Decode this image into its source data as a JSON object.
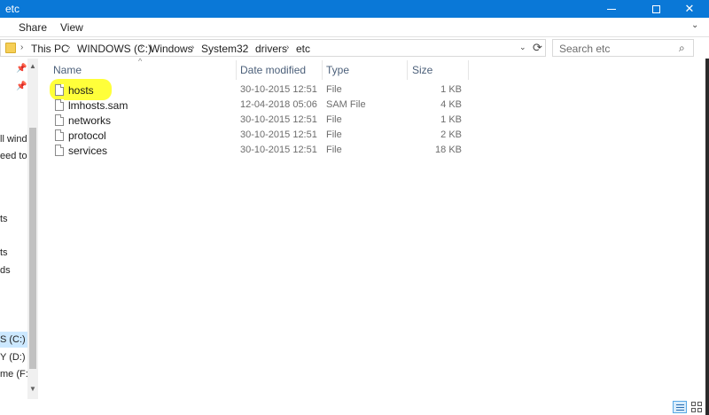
{
  "window": {
    "title": "etc",
    "accent_color": "#0a78d7"
  },
  "ribbon": {
    "tabs": [
      "Share",
      "View"
    ]
  },
  "address": {
    "crumbs": [
      "This PC",
      "WINDOWS (C:)",
      "Windows",
      "System32",
      "drivers",
      "etc"
    ]
  },
  "search": {
    "placeholder": "Search etc"
  },
  "nav": {
    "items": [
      "ll wind",
      "eed to b",
      "ts",
      "ts",
      "ds",
      "S (C:)",
      "Y (D:)",
      "me (F:)"
    ]
  },
  "columns": [
    "Name",
    "Date modified",
    "Type",
    "Size"
  ],
  "files": [
    {
      "name": "hosts",
      "date": "30-10-2015 12:51",
      "type": "File",
      "size": "1 KB",
      "highlighted": true
    },
    {
      "name": "lmhosts.sam",
      "date": "12-04-2018 05:06",
      "type": "SAM File",
      "size": "4 KB",
      "highlighted": false
    },
    {
      "name": "networks",
      "date": "30-10-2015 12:51",
      "type": "File",
      "size": "1 KB",
      "highlighted": false
    },
    {
      "name": "protocol",
      "date": "30-10-2015 12:51",
      "type": "File",
      "size": "2 KB",
      "highlighted": false
    },
    {
      "name": "services",
      "date": "30-10-2015 12:51",
      "type": "File",
      "size": "18 KB",
      "highlighted": false
    }
  ],
  "colors": {
    "highlight": "#ffff3a",
    "selection": "#cce8ff"
  },
  "icons": [
    "minimize-icon",
    "maximize-icon",
    "close-icon",
    "chevron-down-icon",
    "folder-icon",
    "refresh-icon",
    "search-icon",
    "pin-icon",
    "file-icon",
    "details-view-icon",
    "large-icons-view-icon"
  ]
}
